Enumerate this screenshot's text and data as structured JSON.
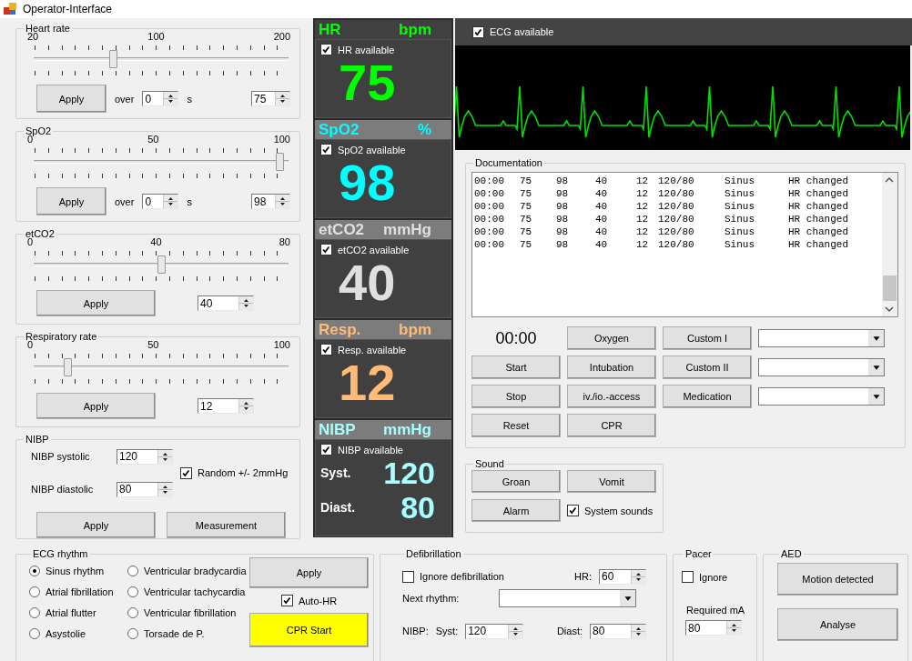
{
  "window": {
    "title": "Operator-Interface"
  },
  "sliders": [
    {
      "title": "Heart rate",
      "scale": [
        "20",
        "100",
        "200"
      ],
      "level": 0.306,
      "apply": "Apply",
      "over_label": "over",
      "over_value": "0",
      "unit": "s",
      "value": "75"
    },
    {
      "title": "SpO2",
      "scale": [
        "0",
        "50",
        "100"
      ],
      "level": 0.98,
      "apply": "Apply",
      "over_label": "over",
      "over_value": "0",
      "unit": "s",
      "value": "98"
    },
    {
      "title": "etCO2",
      "scale": [
        "0",
        "40",
        "80"
      ],
      "level": 0.5,
      "apply": "Apply",
      "value": "40"
    },
    {
      "title": "Respiratory rate",
      "scale": [
        "0",
        "50",
        "100"
      ],
      "level": 0.12,
      "apply": "Apply",
      "value": "12"
    }
  ],
  "nibp": {
    "title": "NIBP",
    "systolic_label": "NIBP systolic",
    "systolic": "120",
    "diastolic_label": "NIBP diastolic",
    "diastolic": "80",
    "random": {
      "label": "Random +/- 2mmHg",
      "checked": true
    },
    "buttons": [
      "Apply",
      "Measurement"
    ]
  },
  "monitor": [
    {
      "kind": "single",
      "label": "HR",
      "unit": "bpm",
      "color": "#00ff00",
      "available": {
        "label": "HR available",
        "checked": true
      },
      "value": "75"
    },
    {
      "kind": "single",
      "label": "SpO2",
      "unit": "%",
      "color": "#00ffff",
      "available": {
        "label": "SpO2 available",
        "checked": true
      },
      "value": "98"
    },
    {
      "kind": "single",
      "label": "etCO2",
      "unit": "mmHg",
      "color": "#e0e0e0",
      "available": {
        "label": "etCO2 available",
        "checked": true
      },
      "value": "40"
    },
    {
      "kind": "single",
      "label": "Resp.",
      "unit": "bpm",
      "color": "#ffbb77",
      "available": {
        "label": "Resp. available",
        "checked": true
      },
      "value": "12"
    },
    {
      "kind": "pair",
      "label": "NIBP",
      "unit": "mmHg",
      "color": "#a8ffff",
      "available": {
        "label": "NIBP available",
        "checked": true
      },
      "values": [
        {
          "label": "Syst.",
          "value": "120"
        },
        {
          "label": "Diast.",
          "value": "80"
        }
      ]
    }
  ],
  "ecg": {
    "available": {
      "label": "ECG available",
      "checked": true
    }
  },
  "documentation": {
    "title": "Documentation",
    "rows": [
      [
        "00:00",
        "75",
        "98",
        "40",
        "12",
        "120/80",
        "Sinus",
        "HR changed"
      ],
      [
        "00:00",
        "75",
        "98",
        "40",
        "12",
        "120/80",
        "Sinus",
        "HR changed"
      ],
      [
        "00:00",
        "75",
        "98",
        "40",
        "12",
        "120/80",
        "Sinus",
        "HR changed"
      ],
      [
        "00:00",
        "75",
        "98",
        "40",
        "12",
        "120/80",
        "Sinus",
        "HR changed"
      ],
      [
        "00:00",
        "75",
        "98",
        "40",
        "12",
        "120/80",
        "Sinus",
        "HR changed"
      ],
      [
        "00:00",
        "75",
        "98",
        "40",
        "12",
        "120/80",
        "Sinus",
        "HR changed"
      ]
    ],
    "controls": [
      {
        "kind": "timer",
        "text": "00:00"
      },
      {
        "kind": "button",
        "text": "Oxygen"
      },
      {
        "kind": "button",
        "text": "Custom I"
      },
      {
        "kind": "combo"
      },
      {
        "kind": "button",
        "text": "Start"
      },
      {
        "kind": "button",
        "text": "Intubation"
      },
      {
        "kind": "button",
        "text": "Custom II"
      },
      {
        "kind": "combo"
      },
      {
        "kind": "button",
        "text": "Stop"
      },
      {
        "kind": "button",
        "text": "iv./io.-access"
      },
      {
        "kind": "button",
        "text": "Medication"
      },
      {
        "kind": "combo"
      },
      {
        "kind": "button",
        "text": "Reset"
      },
      {
        "kind": "button",
        "text": "CPR"
      }
    ]
  },
  "sound": {
    "title": "Sound",
    "buttons": [
      "Groan",
      "Vomit",
      "Alarm"
    ],
    "system": {
      "label": "System sounds",
      "checked": true
    }
  },
  "rhythm": {
    "title": "ECG rhythm",
    "options": [
      {
        "label": "Sinus rhythm",
        "selected": true
      },
      {
        "label": "Atrial fibrillation",
        "selected": false
      },
      {
        "label": "Atrial flutter",
        "selected": false
      },
      {
        "label": "Asystolie",
        "selected": false
      },
      {
        "label": "Ventricular bradycardia",
        "selected": false
      },
      {
        "label": "Ventricular tachycardia",
        "selected": false
      },
      {
        "label": "Ventricular fibrillation",
        "selected": false
      },
      {
        "label": "Torsade de P.",
        "selected": false
      }
    ],
    "apply": "Apply",
    "auto_hr": {
      "label": "Auto-HR",
      "checked": true
    },
    "cpr": "CPR Start"
  },
  "defibrillation": {
    "title": "Defibrillation",
    "ignore": {
      "label": "Ignore defibrillation",
      "checked": false
    },
    "hr_label": "HR:",
    "hr": "60",
    "next_label": "Next rhythm:",
    "nibp_label": "NIBP:",
    "syst_label": "Syst:",
    "syst": "120",
    "diast_label": "Diast:",
    "diast": "80"
  },
  "pacer": {
    "title": "Pacer",
    "ignore": {
      "label": "Ignore",
      "checked": false
    },
    "required_label": "Required mA",
    "required": "80"
  },
  "aed": {
    "title": "AED",
    "buttons": [
      "Motion detected",
      "Analyse"
    ]
  }
}
